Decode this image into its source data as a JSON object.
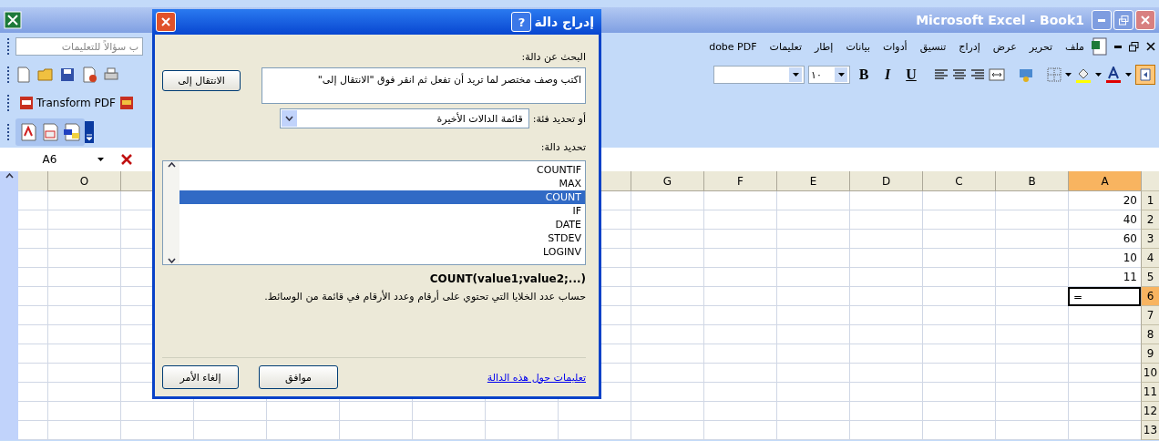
{
  "window": {
    "title": "Microsoft Excel - Book1"
  },
  "menu_bar": {
    "question_field": {
      "value": "ب سؤالاً للتعليمات"
    },
    "items": [
      "ملف",
      "تحرير",
      "عرض",
      "إدراج",
      "تنسيق",
      "أدوات",
      "بيانات",
      "إطار",
      "تعليمات",
      "dobe PDF"
    ]
  },
  "formatting_toolbar": {
    "font_size": "١٠",
    "style_buttons": [
      {
        "label": "U",
        "kind": "underline"
      },
      {
        "label": "I",
        "kind": "italic"
      },
      {
        "label": "B",
        "kind": "bold"
      }
    ]
  },
  "pdf_toolbar": {
    "label": "Transform PDF"
  },
  "formula_bar": {
    "name_box": "A6"
  },
  "sheet": {
    "columns_right": [
      {
        "label": "A",
        "selected": true
      },
      {
        "label": "B",
        "selected": false
      },
      {
        "label": "C",
        "selected": false
      },
      {
        "label": "D",
        "selected": false
      },
      {
        "label": "E",
        "selected": false
      },
      {
        "label": "F",
        "selected": false
      },
      {
        "label": "G",
        "selected": false
      }
    ],
    "columns_left": [
      "O"
    ],
    "rows": [
      {
        "number": "1",
        "selected": false,
        "cell": "20"
      },
      {
        "number": "2",
        "selected": false,
        "cell": "40"
      },
      {
        "number": "3",
        "selected": false,
        "cell": "60"
      },
      {
        "number": "4",
        "selected": false,
        "cell": "10"
      },
      {
        "number": "5",
        "selected": false,
        "cell": "11"
      },
      {
        "number": "6",
        "selected": true,
        "cell": "="
      },
      {
        "number": "7",
        "selected": false
      },
      {
        "number": "8",
        "selected": false
      },
      {
        "number": "9",
        "selected": false
      },
      {
        "number": "10",
        "selected": false
      },
      {
        "number": "11",
        "selected": false
      },
      {
        "number": "12",
        "selected": false
      },
      {
        "number": "13",
        "selected": false
      }
    ]
  },
  "dialog": {
    "title": "إدراج دالة",
    "help": "?",
    "search_label": "البحث عن دالة:",
    "search_value": "اكتب وصف مختصر لما تريد أن تفعل ثم انقر فوق \"الانتقال إلى\"",
    "go_button": "الانتقال إلى",
    "category_label": "أو تحديد فئة:",
    "category_value": "قائمة الدالات الأخيرة",
    "function_label": "تحديد دالة:",
    "functions": [
      {
        "name": "COUNTIF",
        "selected": false
      },
      {
        "name": "MAX",
        "selected": false
      },
      {
        "name": "COUNT",
        "selected": true
      },
      {
        "name": "IF",
        "selected": false
      },
      {
        "name": "DATE",
        "selected": false
      },
      {
        "name": "STDEV",
        "selected": false
      },
      {
        "name": "LOGINV",
        "selected": false
      }
    ],
    "syntax": "COUNT(value1;value2;...)",
    "description": "حساب عدد الخلايا التي تحتوي على أرقام وعدد الأرقام في قائمة من الوسائط.",
    "help_link": "تعليمات حول هذه الدالة",
    "ok_button": "موافق",
    "cancel_button": "إلغاء الأمر"
  }
}
